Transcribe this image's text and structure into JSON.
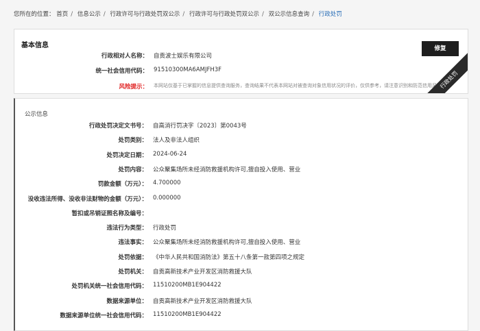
{
  "breadcrumb": {
    "prefix": "您所在的位置：",
    "items": [
      "首页",
      "信息公示",
      "行政许可与行政处罚双公示",
      "行政许可与行政处罚双公示",
      "双公示信息查询"
    ],
    "current": "行政处罚",
    "separator": "/"
  },
  "basic": {
    "title": "基本信息",
    "fix_button": "修复",
    "ribbon": "行政处罚",
    "rows": [
      {
        "label": "行政相对人名称：",
        "value": "自贡波士娱乐有限公司"
      },
      {
        "label": "统一社会信用代码：",
        "value": "91510300MA6AMJFH3F"
      }
    ],
    "risk": {
      "label": "风险提示：",
      "value": "本网站仅基于已掌握的信息提供查询服务，查询结果不代表本网站对被查询对象信用状况的评价，仅供参考，请注意识别和防范信用风险"
    }
  },
  "public": {
    "title": "公示信息",
    "rows": [
      {
        "label": "行政处罚决定文书号：",
        "value": "自高消行罚决字〔2023〕第0043号"
      },
      {
        "label": "处罚类别：",
        "value": "法人及非法人组织"
      },
      {
        "label": "处罚决定日期：",
        "value": "2024-06-24"
      },
      {
        "label": "处罚内容：",
        "value": "公众聚集场所未经消防救援机构许可,擅自投入使用、营业"
      },
      {
        "label": "罚款金额（万元）：",
        "value": "4.700000"
      },
      {
        "label": "没收违法所得、没收非法财物的金额（万元）：",
        "value": "0.000000"
      },
      {
        "label": "暂扣或吊销证照名称及编号：",
        "value": ""
      },
      {
        "label": "违法行为类型：",
        "value": "行政处罚"
      },
      {
        "label": "违法事实：",
        "value": "公众聚集场所未经消防救援机构许可,擅自投入使用、营业"
      },
      {
        "label": "处罚依据：",
        "value": "《中华人民共和国消防法》第五十八条第一款第四项之规定"
      },
      {
        "label": "处罚机关：",
        "value": "自贡高新技术产业开发区消防救援大队"
      },
      {
        "label": "处罚机关统一社会信用代码：",
        "value": "11510200MB1E904422"
      },
      {
        "label": "数据来源单位：",
        "value": "自贡高新技术产业开发区消防救援大队"
      },
      {
        "label": "数据来源单位统一社会信用代码：",
        "value": "11510200MB1E904422"
      }
    ]
  }
}
